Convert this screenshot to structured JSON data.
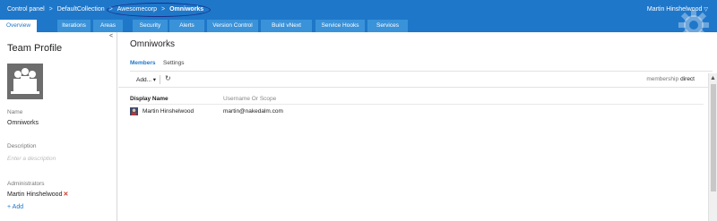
{
  "breadcrumb": {
    "items": [
      "Control panel",
      "DefaultCollection",
      "Awesomecorp",
      "Omniworks"
    ],
    "separator": ">"
  },
  "user": {
    "name": "Martin Hinshelwood",
    "menu_icon": "chevron-down-icon"
  },
  "tabs": [
    {
      "label": "Overview",
      "active": true
    },
    {
      "label": "Iterations",
      "active": false
    },
    {
      "label": "Areas",
      "active": false
    },
    {
      "label": "Security",
      "active": false
    },
    {
      "label": "Alerts",
      "active": false
    },
    {
      "label": "Version Control",
      "active": false
    },
    {
      "label": "Build vNext",
      "active": false
    },
    {
      "label": "Service Hooks",
      "active": false
    },
    {
      "label": "Services",
      "active": false
    }
  ],
  "left_pane": {
    "collapse_icon": "<",
    "title": "Team Profile",
    "name_label": "Name",
    "name_value": "Omniworks",
    "description_label": "Description",
    "description_placeholder": "Enter a description",
    "administrators_label": "Administrators",
    "administrator": "Martin Hinshelwood",
    "remove_icon": "✕",
    "add_label": "+ Add"
  },
  "main": {
    "title": "Omniworks",
    "subtabs": [
      {
        "label": "Members",
        "active": true
      },
      {
        "label": "Settings",
        "active": false
      }
    ],
    "toolbar": {
      "add_label": "Add...",
      "add_chevron": "▾",
      "refresh_icon": "↻",
      "membership_label": "membership",
      "membership_value": "direct"
    },
    "grid": {
      "columns": [
        "Display Name",
        "Username Or Scope"
      ],
      "rows": [
        {
          "display_name": "Martin Hinshelwood",
          "username": "martin@nakedalm.com"
        }
      ]
    }
  },
  "scrollbar": {
    "up_icon": "▲"
  },
  "colors": {
    "accent": "#1f77c9",
    "tab_inactive": "#3a92d9",
    "highlight_circle": "#1a2f8a"
  }
}
